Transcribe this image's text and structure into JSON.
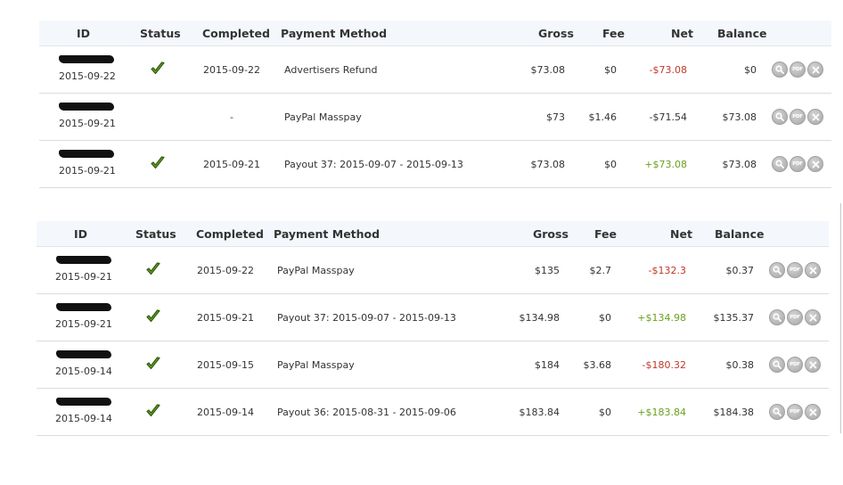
{
  "headers": {
    "id": "ID",
    "status": "Status",
    "completed": "Completed",
    "payment_method": "Payment Method",
    "gross": "Gross",
    "fee": "Fee",
    "net": "Net",
    "balance": "Balance"
  },
  "tables": [
    {
      "rows": [
        {
          "id_date": "2015-09-22",
          "status": "check",
          "completed": "2015-09-22",
          "method": "Advertisers Refund",
          "gross": "$73.08",
          "fee": "$0",
          "net": "-$73.08",
          "net_sign": "neg",
          "balance": "$0"
        },
        {
          "id_date": "2015-09-21",
          "status": "",
          "completed": "-",
          "method": "PayPal Masspay",
          "gross": "$73",
          "fee": "$1.46",
          "net": "-$71.54",
          "net_sign": "plain",
          "balance": "$73.08"
        },
        {
          "id_date": "2015-09-21",
          "status": "check",
          "completed": "2015-09-21",
          "method": "Payout 37: 2015-09-07 - 2015-09-13",
          "gross": "$73.08",
          "fee": "$0",
          "net": "+$73.08",
          "net_sign": "pos",
          "balance": "$73.08"
        }
      ]
    },
    {
      "rows": [
        {
          "id_date": "2015-09-21",
          "status": "check",
          "completed": "2015-09-22",
          "method": "PayPal Masspay",
          "gross": "$135",
          "fee": "$2.7",
          "net": "-$132.3",
          "net_sign": "neg",
          "balance": "$0.37"
        },
        {
          "id_date": "2015-09-21",
          "status": "check",
          "completed": "2015-09-21",
          "method": "Payout 37: 2015-09-07 - 2015-09-13",
          "gross": "$134.98",
          "fee": "$0",
          "net": "+$134.98",
          "net_sign": "pos",
          "balance": "$135.37"
        },
        {
          "id_date": "2015-09-14",
          "status": "check",
          "completed": "2015-09-15",
          "method": "PayPal Masspay",
          "gross": "$184",
          "fee": "$3.68",
          "net": "-$180.32",
          "net_sign": "neg",
          "balance": "$0.38"
        },
        {
          "id_date": "2015-09-14",
          "status": "check",
          "completed": "2015-09-14",
          "method": "Payout 36: 2015-08-31 - 2015-09-06",
          "gross": "$183.84",
          "fee": "$0",
          "net": "+$183.84",
          "net_sign": "pos",
          "balance": "$184.38"
        }
      ]
    }
  ],
  "actions": {
    "view_icon": "magnifier-icon",
    "pdf_icon": "pdf-icon",
    "pdf_label": "PDF",
    "delete_icon": "close-icon"
  },
  "colors": {
    "negative": "#c0392b",
    "positive": "#6aa01f",
    "header_bg": "#f4f7fb",
    "check": "#4e8a1f"
  }
}
